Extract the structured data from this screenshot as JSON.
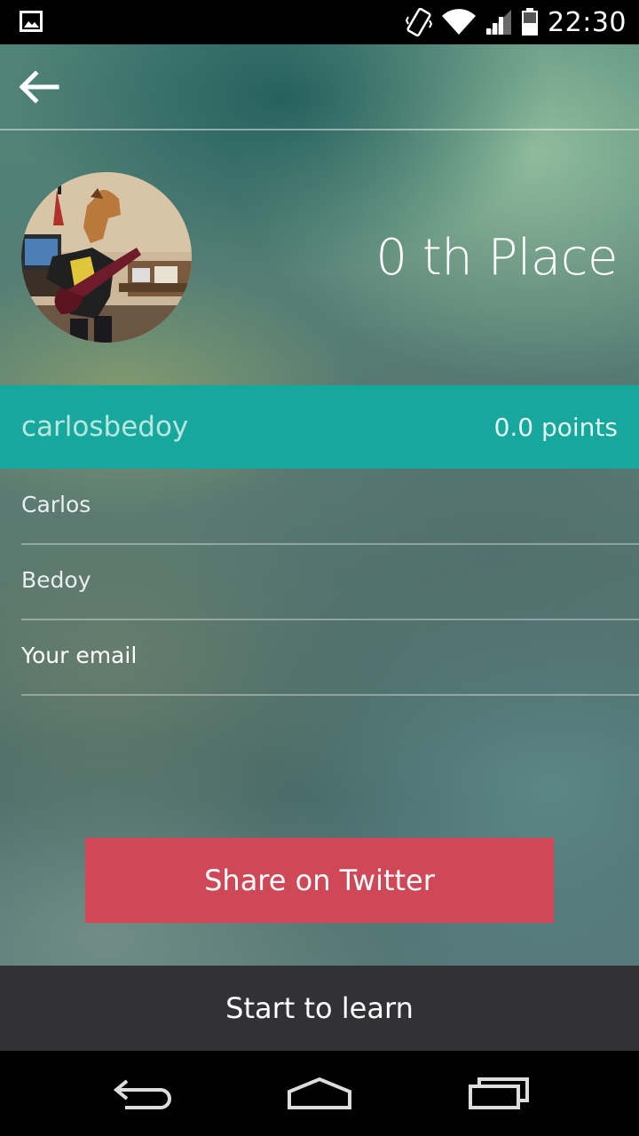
{
  "status_bar": {
    "time": "22:30",
    "icons": [
      "image-notification-icon",
      "vibrate-icon",
      "wifi-icon",
      "signal-icon",
      "battery-icon"
    ]
  },
  "header": {
    "back_icon": "arrow-left-icon"
  },
  "profile": {
    "avatar": "avatar",
    "place": "0 th Place",
    "username": "carlosbedoy",
    "points": "0.0 points"
  },
  "form": {
    "first_name": "Carlos",
    "last_name": "Bedoy",
    "email_placeholder": "Your email"
  },
  "actions": {
    "share_label": "Share on Twitter",
    "start_label": "Start to learn"
  },
  "colors": {
    "user_bar": "#17a89d",
    "twitter_button": "#cf4857",
    "learn_bar": "#313136"
  },
  "nav": {
    "icons": [
      "back-nav-icon",
      "home-nav-icon",
      "recents-nav-icon"
    ]
  }
}
